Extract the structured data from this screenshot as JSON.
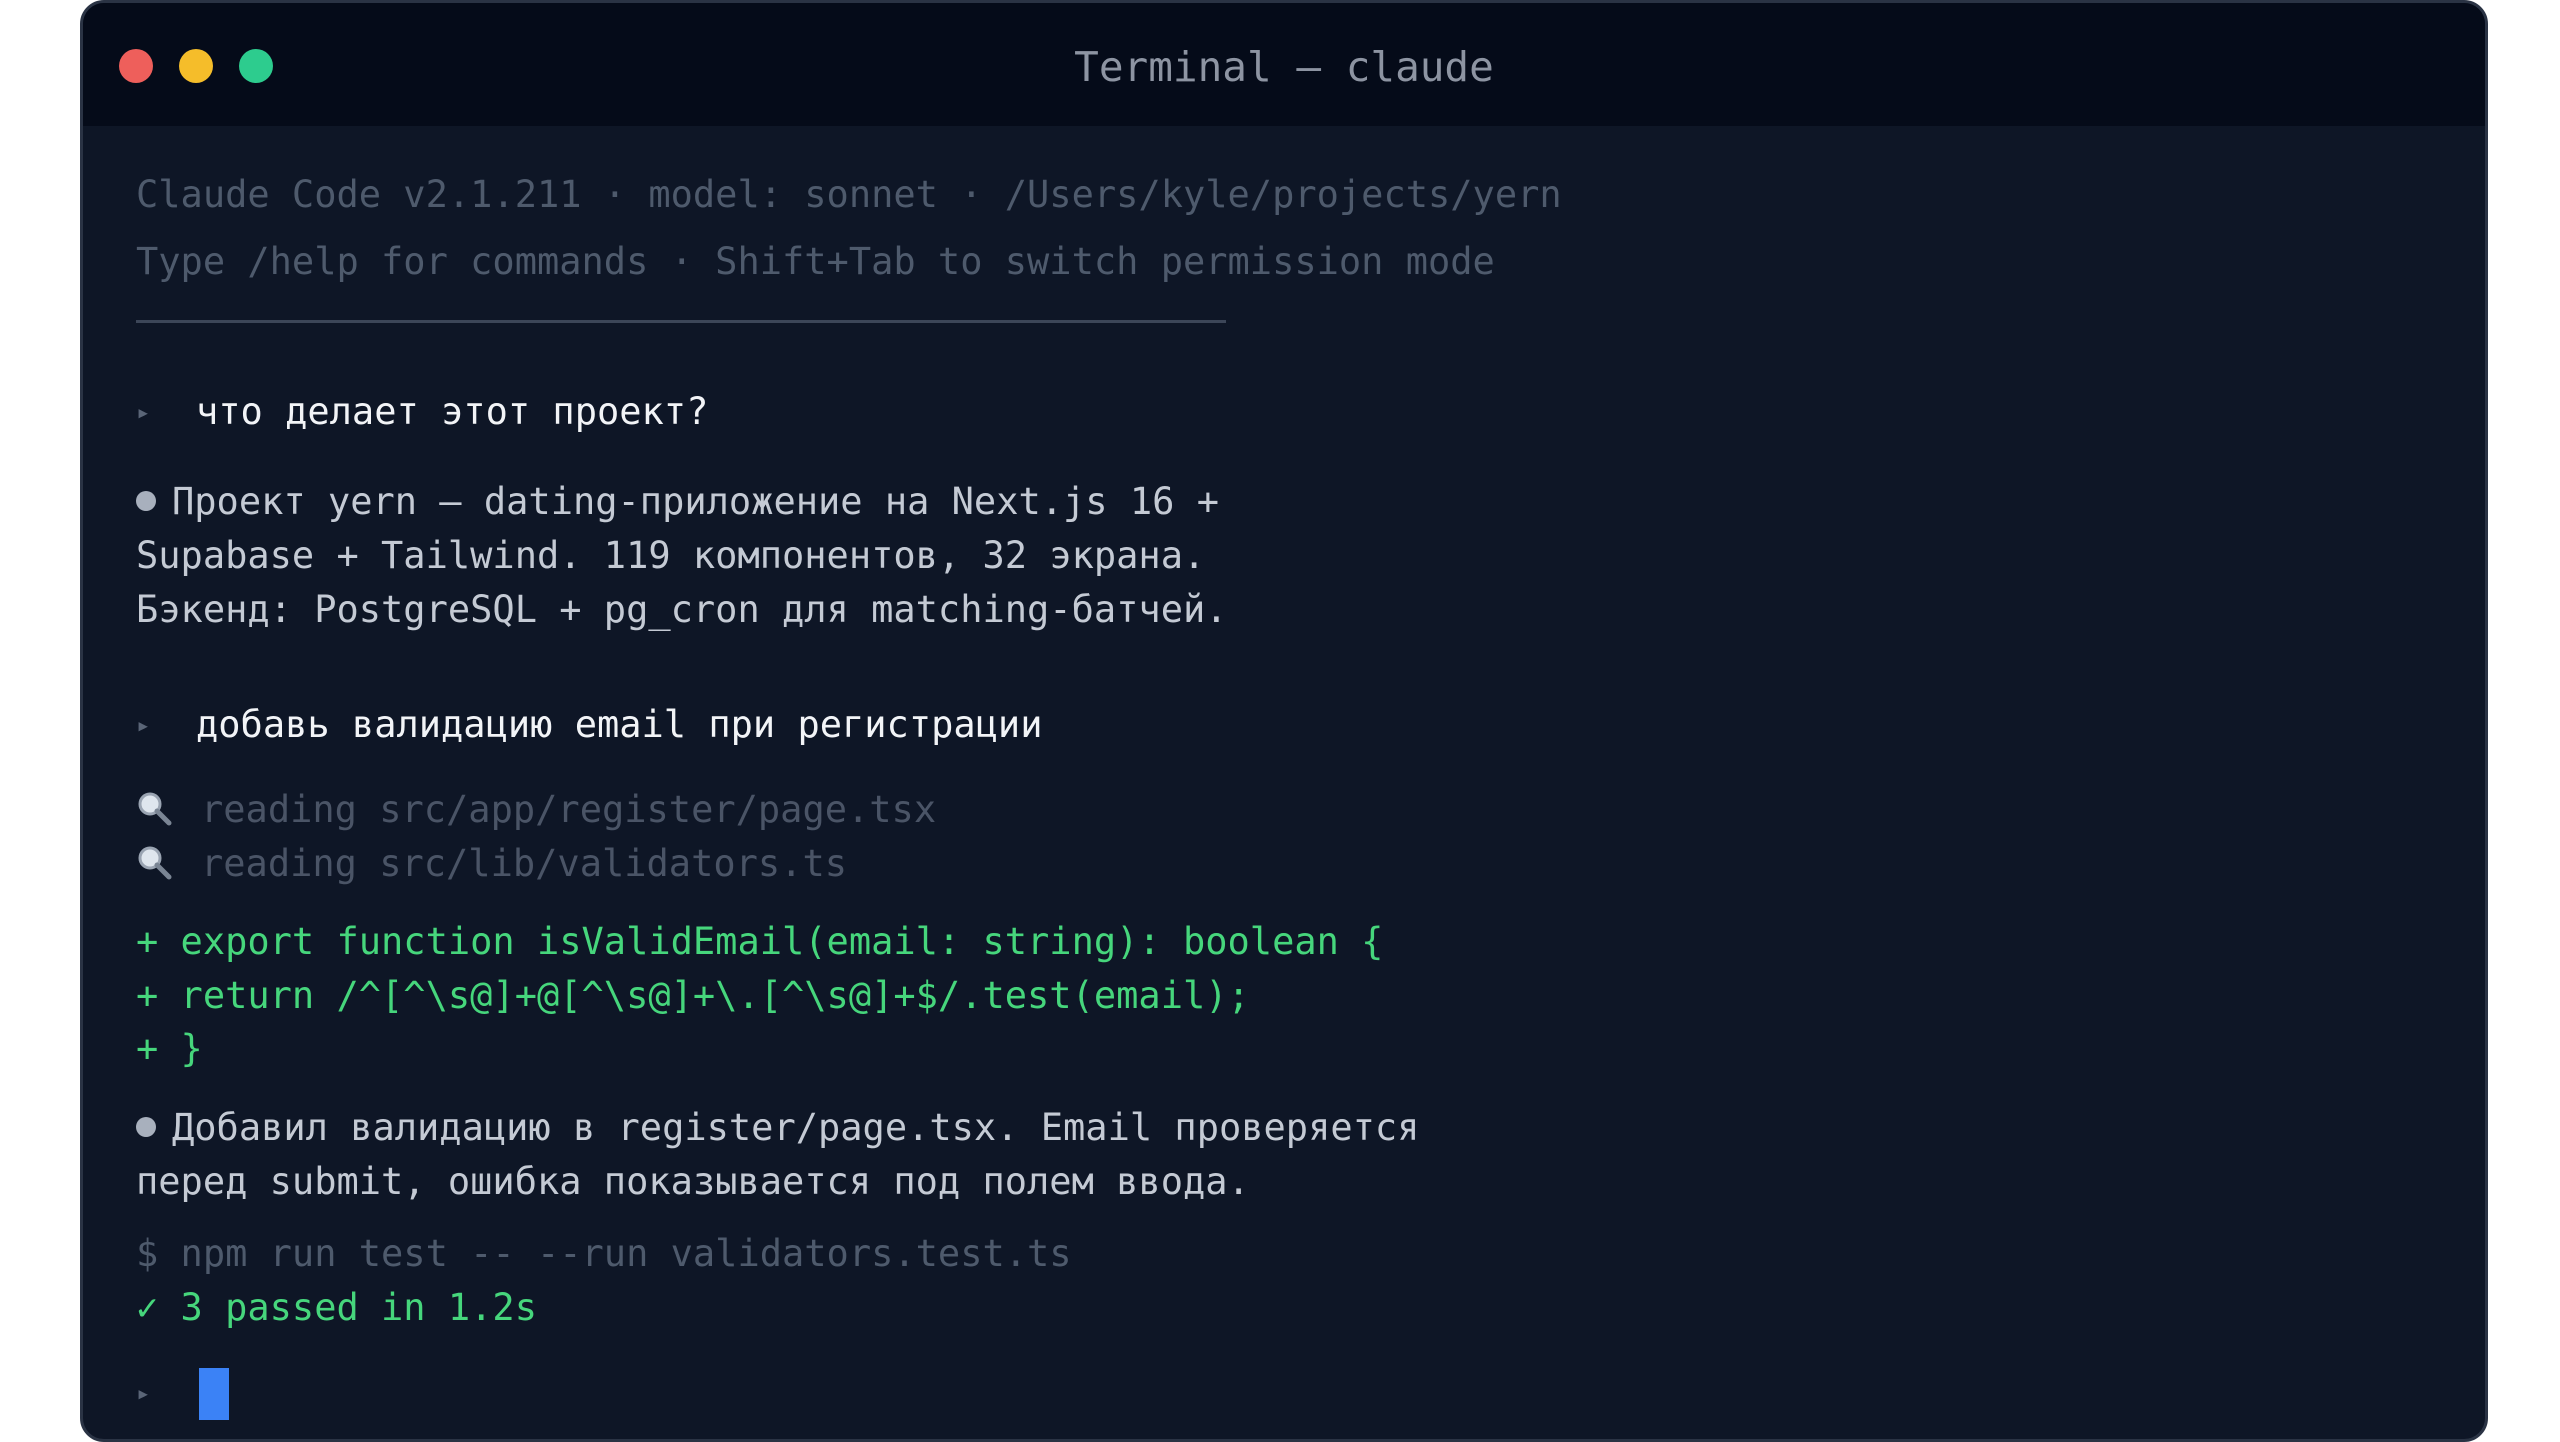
{
  "window": {
    "title": "Terminal — claude",
    "controls": [
      "close",
      "minimize",
      "maximize"
    ]
  },
  "header": {
    "line1": "Claude Code v2.1.211 · model: sonnet · /Users/kyle/projects/yern",
    "line2": "Type /help for commands · Shift+Tab to switch permission mode"
  },
  "conversation": {
    "prompt_marker": "▸",
    "user_message_1": "что делает этот проект?",
    "assistant_reply_1": [
      "Проект yern — dating-приложение на Next.js 16 +",
      "Supabase + Tailwind. 119 компонентов, 32 экрана.",
      "Бэкенд: PostgreSQL + pg_cron для matching-батчей."
    ],
    "user_message_2": "добавь валидацию email при регистрации",
    "tool_calls": [
      {
        "icon": "magnifier-icon",
        "text": "reading src/app/register/page.tsx"
      },
      {
        "icon": "magnifier-icon",
        "text": "reading src/lib/validators.ts"
      }
    ],
    "diff_lines": [
      "+ export function isValidEmail(email: string): boolean {",
      "+ return /^[^\\s@]+@[^\\s@]+\\.[^\\s@]+$/.test(email);",
      "+ }"
    ],
    "assistant_reply_2": [
      "Добавил валидацию в register/page.tsx. Email проверяется",
      "перед submit, ошибка показывается под полем ввода."
    ],
    "command": "$ npm run test -- --run validators.test.ts",
    "command_result": "✓ 3 passed in 1.2s"
  },
  "colors": {
    "background": "#0e1626",
    "titlebar": "#050b19",
    "diff_green": "#46d67c",
    "cursor": "#3b82f6",
    "close": "#ee5f5b",
    "minimize": "#f5bd2a",
    "maximize": "#2dcc8e"
  }
}
